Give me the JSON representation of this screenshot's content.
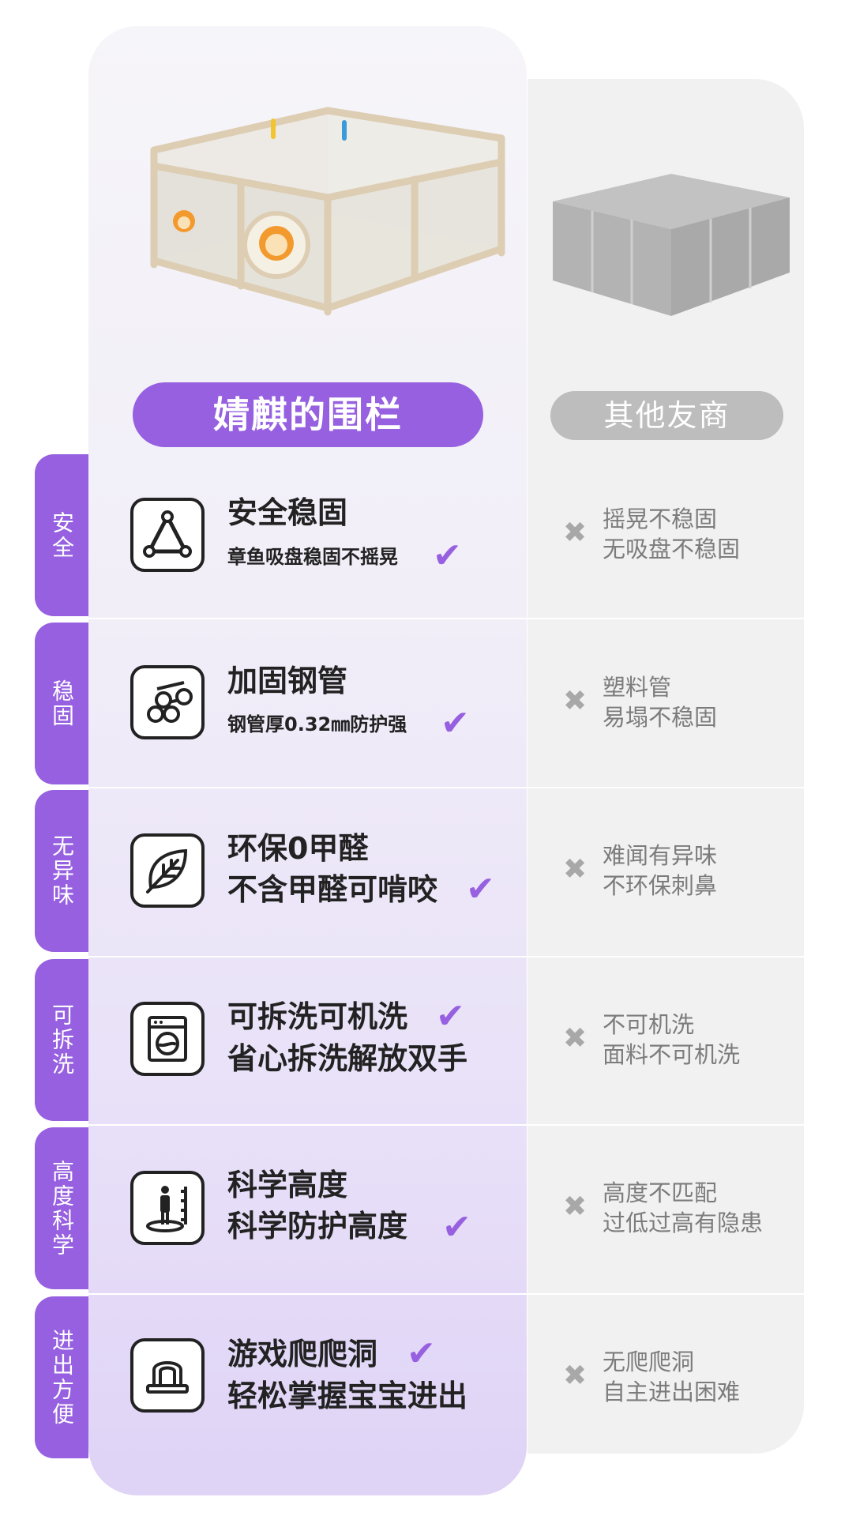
{
  "colors": {
    "accent": "#9660e0",
    "rival_gray": "#bdbdbd",
    "text_dark": "#222222",
    "text_gray": "#7c7c7c"
  },
  "header": {
    "brand_label": "婧麒的围栏",
    "rival_label": "其他友商"
  },
  "rows": [
    {
      "tab": "安全",
      "icon": "triangle-stability-icon",
      "title": "安全稳固",
      "subtitle": "章鱼吸盘稳固不摇晃",
      "check": "✔",
      "x": "✖",
      "rival_line1": "摇晃不稳固",
      "rival_line2": "无吸盘不稳固"
    },
    {
      "tab": "稳固",
      "icon": "steel-pipe-icon",
      "title": "加固钢管",
      "subtitle": "钢管厚0.32㎜防护强",
      "check": "✔",
      "x": "✖",
      "rival_line1": "塑料管",
      "rival_line2": "易塌不稳固"
    },
    {
      "tab": "无异味",
      "icon": "leaf-icon",
      "title": "环保0甲醛",
      "subtitle": "不含甲醛可啃咬",
      "check": "✔",
      "x": "✖",
      "rival_line1": "难闻有异味",
      "rival_line2": "不环保刺鼻"
    },
    {
      "tab": "可拆洗",
      "icon": "washing-machine-icon",
      "title": "可拆洗可机洗",
      "subtitle": "省心拆洗解放双手",
      "check": "✔",
      "x": "✖",
      "rival_line1": "不可机洗",
      "rival_line2": "面料不可机洗"
    },
    {
      "tab": "高度科学",
      "icon": "height-measure-icon",
      "title": "科学高度",
      "subtitle": "科学防护高度",
      "check": "✔",
      "x": "✖",
      "rival_line1": "高度不匹配",
      "rival_line2": "过低过高有隐患"
    },
    {
      "tab": "进出方便",
      "icon": "crawl-tunnel-icon",
      "title": "游戏爬爬洞",
      "subtitle": "轻松掌握宝宝进出",
      "check": "✔",
      "x": "✖",
      "rival_line1": "无爬爬洞",
      "rival_line2": "自主进出困难"
    }
  ]
}
